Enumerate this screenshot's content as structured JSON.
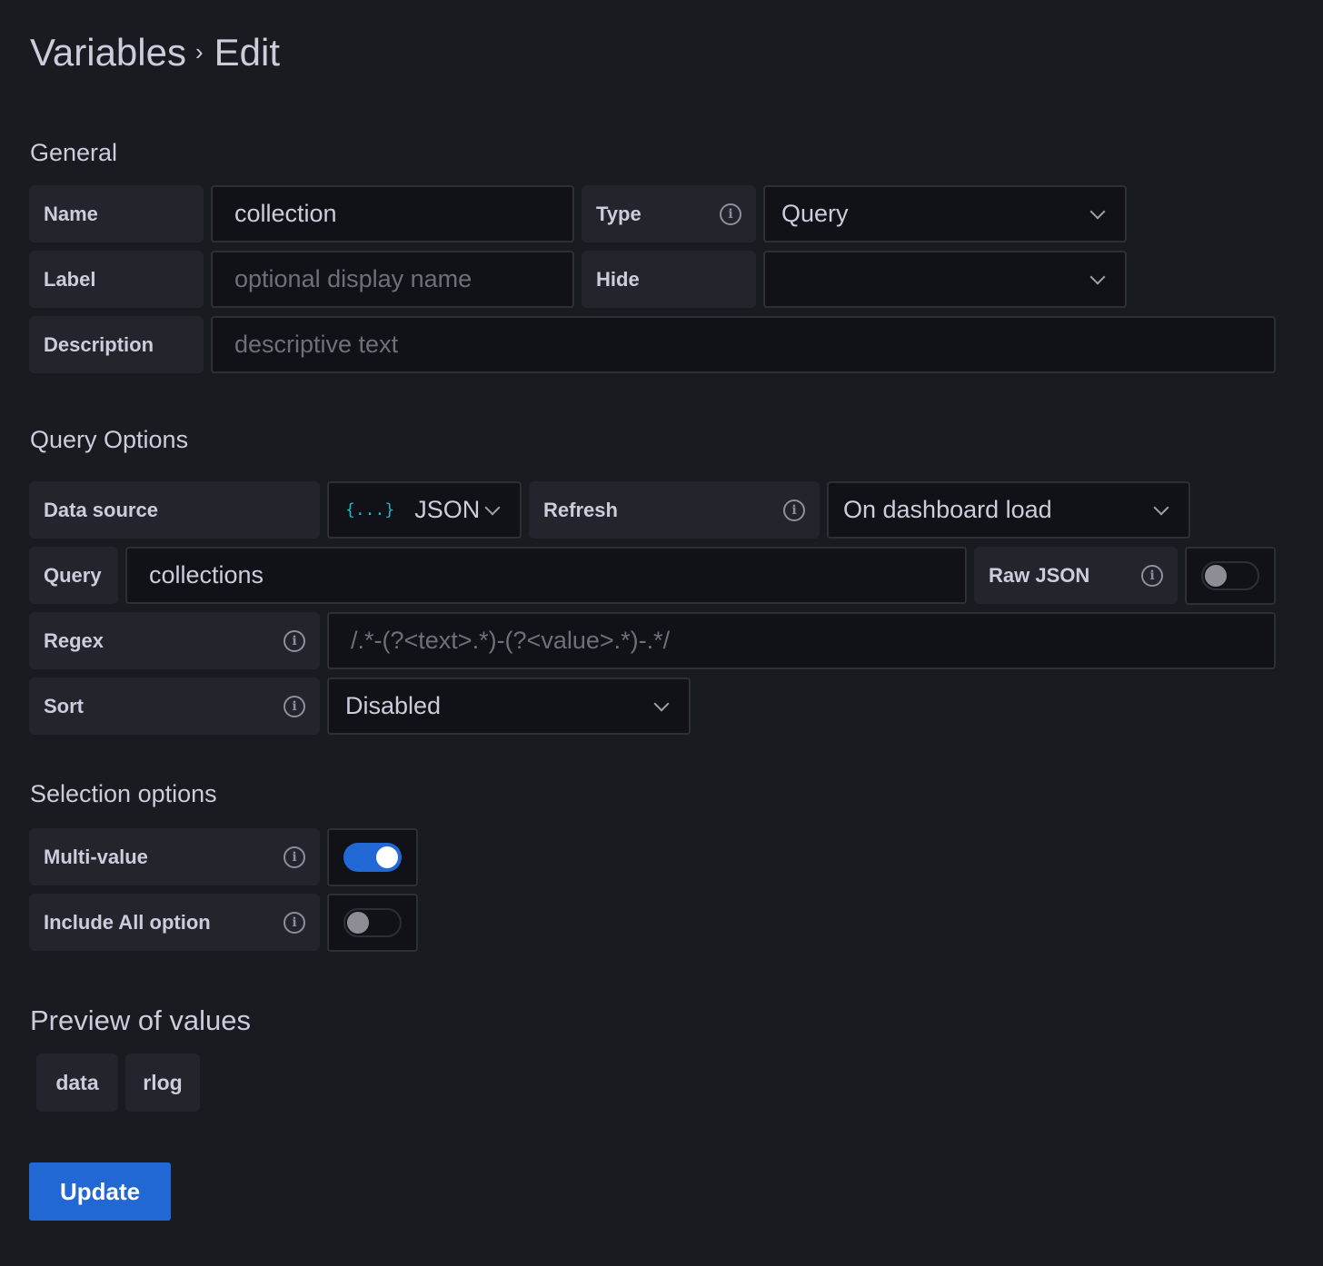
{
  "header": {
    "breadcrumb_parent": "Variables",
    "separator": "›",
    "breadcrumb_current": "Edit"
  },
  "general": {
    "title": "General",
    "name_label": "Name",
    "name_value": "collection",
    "type_label": "Type",
    "type_value": "Query",
    "label_label": "Label",
    "label_placeholder": "optional display name",
    "hide_label": "Hide",
    "hide_value": "",
    "description_label": "Description",
    "description_placeholder": "descriptive text"
  },
  "query_options": {
    "title": "Query Options",
    "datasource_label": "Data source",
    "datasource_icon": "{...}",
    "datasource_value": "JSON",
    "refresh_label": "Refresh",
    "refresh_value": "On dashboard load",
    "query_label": "Query",
    "query_value": "collections",
    "raw_json_label": "Raw JSON",
    "raw_json_enabled": false,
    "regex_label": "Regex",
    "regex_placeholder": "/.*-(?<text>.*)-(?<value>.*)-.*/",
    "sort_label": "Sort",
    "sort_value": "Disabled"
  },
  "selection_options": {
    "title": "Selection options",
    "multi_value_label": "Multi-value",
    "multi_value_enabled": true,
    "include_all_label": "Include All option",
    "include_all_enabled": false
  },
  "preview": {
    "title": "Preview of values",
    "values": [
      "data",
      "rlog"
    ]
  },
  "actions": {
    "update_label": "Update"
  },
  "colors": {
    "background": "#181b1f",
    "primary": "#2268d4",
    "text": "#ccccdc",
    "json_icon": "#1fb5c4"
  }
}
